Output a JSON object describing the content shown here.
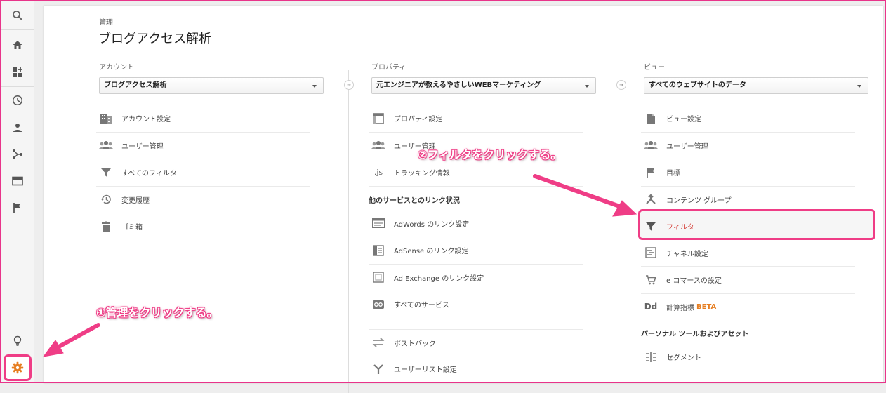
{
  "header": {
    "breadcrumb": "管理",
    "title": "ブログアクセス解析"
  },
  "account": {
    "label": "アカウント",
    "selected": "ブログアクセス解析",
    "items": [
      "アカウント設定",
      "ユーザー管理",
      "すべてのフィルタ",
      "変更履歴",
      "ゴミ箱"
    ]
  },
  "property": {
    "label": "プロパティ",
    "selected": "元エンジニアが教えるやさしいWEBマーケティング",
    "items": [
      "プロパティ設定",
      "ユーザー管理",
      "トラッキング情報"
    ],
    "js_text": ".js",
    "section": "他のサービスとのリンク状況",
    "links": [
      "AdWords のリンク設定",
      "AdSense のリンク設定",
      "Ad Exchange のリンク設定",
      "すべてのサービス"
    ],
    "more": [
      "ポストバック",
      "ユーザーリスト設定"
    ]
  },
  "view": {
    "label": "ビュー",
    "selected": "すべてのウェブサイトのデータ",
    "items": [
      "ビュー設定",
      "ユーザー管理",
      "目標",
      "コンテンツ グループ",
      "フィルタ",
      "チャネル設定",
      "e コマースの設定",
      "計算指標"
    ],
    "dd_text": "Dd",
    "beta": "BETA",
    "section": "パーソナル ツールおよびアセット",
    "tools": [
      "セグメント"
    ]
  },
  "annotations": {
    "step1": "①管理をクリックする。",
    "step2": "②フィルタをクリックする。"
  },
  "colors": {
    "highlight": "#ef3d86",
    "gear": "#e67e22",
    "filter_text": "#d5413a",
    "beta": "#e67e22"
  },
  "rail_icons": [
    "search-icon",
    "home-icon",
    "dashboard-icon",
    "clock-icon",
    "person-icon",
    "acquisition-icon",
    "behavior-icon",
    "flag-icon",
    "lightbulb-icon",
    "gear-icon"
  ]
}
